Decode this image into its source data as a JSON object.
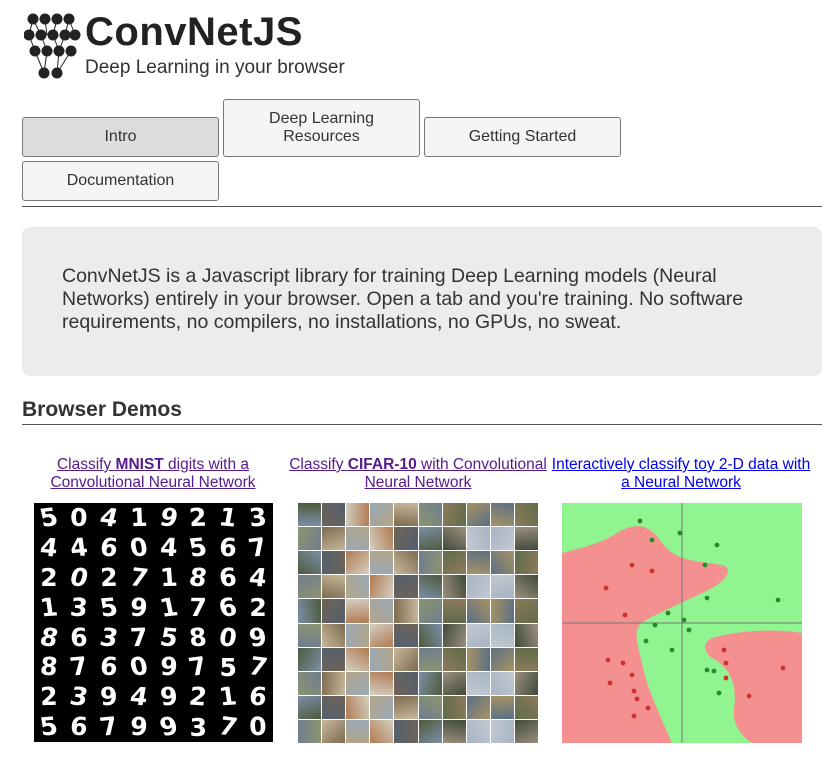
{
  "header": {
    "title": "ConvNetJS",
    "subtitle": "Deep Learning in your browser",
    "logo_icon": "neural-network-logo"
  },
  "nav": {
    "tabs": [
      {
        "label": "Intro",
        "active": true
      },
      {
        "label": "Deep Learning Resources",
        "active": false
      },
      {
        "label": "Getting Started",
        "active": false
      },
      {
        "label": "Documentation",
        "active": false
      }
    ]
  },
  "intro": {
    "text": "ConvNetJS is a Javascript library for training Deep Learning models (Neural Networks) entirely in your browser. Open a tab and you're training. No software requirements, no compilers, no installations, no GPUs, no sweat."
  },
  "demos": {
    "title": "Browser Demos",
    "items": [
      {
        "pre": "Classify ",
        "bold": "MNIST",
        "post": " digits with a Convolutional Neural Network",
        "image": "mnist-digits-grid"
      },
      {
        "pre": "Classify ",
        "bold": "CIFAR-10",
        "post": " with Convolutional Neural Network",
        "image": "cifar10-image-grid"
      },
      {
        "pre": "",
        "bold": "",
        "post": "Interactively classify toy 2-D data with a Neural Network",
        "image": "2d-classification-plot"
      }
    ]
  },
  "mnist_digits": [
    "5",
    "0",
    "4",
    "1",
    "9",
    "2",
    "1",
    "3",
    "4",
    "4",
    "6",
    "0",
    "4",
    "5",
    "6",
    "7",
    "2",
    "0",
    "2",
    "7",
    "1",
    "8",
    "6",
    "4",
    "1",
    "3",
    "5",
    "9",
    "1",
    "7",
    "6",
    "2",
    "8",
    "6",
    "3",
    "7",
    "5",
    "8",
    "0",
    "9",
    "8",
    "7",
    "6",
    "0",
    "9",
    "7",
    "5",
    "7",
    "2",
    "3",
    "9",
    "4",
    "9",
    "2",
    "1",
    "6",
    "5",
    "6",
    "7",
    "9",
    "9",
    "3",
    "7",
    "0"
  ],
  "colors": {
    "plot_green": "#90f590",
    "plot_red": "#f59090",
    "points_dark": "#2a8a2a",
    "points_red": "#d03030"
  }
}
